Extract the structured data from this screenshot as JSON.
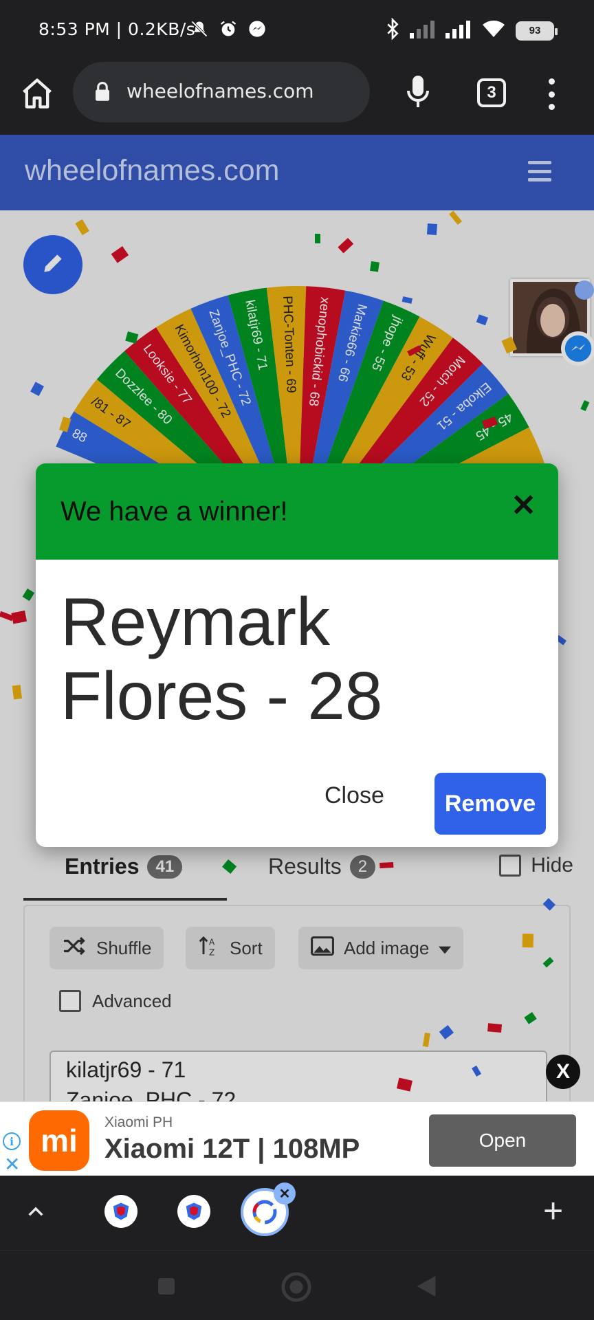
{
  "status_bar": {
    "time": "8:53 PM | 0.2KB/s",
    "battery": "93"
  },
  "browser": {
    "url": "wheelofnames.com",
    "tab_count": "3"
  },
  "site": {
    "brand": "wheelofnames.com"
  },
  "wheel": {
    "segments": [
      {
        "label": "88",
        "color": "#3369e8"
      },
      {
        "label": "/81 - 87",
        "color": "#eeb211"
      },
      {
        "label": "Dozzlee - 80",
        "color": "#009925"
      },
      {
        "label": "Looksie - 77",
        "color": "#d50f25"
      },
      {
        "label": "Kimorhon100 - 72",
        "color": "#eeb211"
      },
      {
        "label": "Zanjoe_PHC - 72",
        "color": "#3369e8"
      },
      {
        "label": "kilatjr69 - 71",
        "color": "#009925"
      },
      {
        "label": "PHC-Tonten - 69",
        "color": "#eeb211"
      },
      {
        "label": "xenophobickid - 68",
        "color": "#d50f25"
      },
      {
        "label": "Markie66 - 66",
        "color": "#3369e8"
      },
      {
        "label": "jhope - 55",
        "color": "#009925"
      },
      {
        "label": "Wuff - 53",
        "color": "#eeb211"
      },
      {
        "label": "Motch - 52",
        "color": "#d50f25"
      },
      {
        "label": "Elkoba - 51",
        "color": "#3369e8"
      },
      {
        "label": "45 - 45",
        "color": "#009925"
      },
      {
        "label": "",
        "color": "#eeb211"
      }
    ]
  },
  "dialog": {
    "title": "We have a winner!",
    "close_icon": "✕",
    "winner_line1": "Reymark",
    "winner_line2": "Flores - 28",
    "close_label": "Close",
    "remove_label": "Remove"
  },
  "tabs": {
    "entries_label": "Entries",
    "entries_count": "41",
    "results_label": "Results",
    "results_count": "2",
    "hide_label": "Hide"
  },
  "toolbar": {
    "shuffle_label": "Shuffle",
    "sort_label": "Sort",
    "add_image_label": "Add image",
    "advanced_label": "Advanced"
  },
  "entries_text": [
    "kilatjr69 - 71",
    "Zanjoe_PHC - 72"
  ],
  "ad": {
    "advertiser": "Xiaomi PH",
    "headline": "Xiaomi 12T | 108MP",
    "cta": "Open",
    "logo_text": "mi",
    "close_text": "X"
  },
  "tab_strip": {
    "plus": "+"
  },
  "colors": {
    "header": "#2f4da6",
    "dialog_header": "#079a2c",
    "primary_button": "#2f62e8"
  }
}
